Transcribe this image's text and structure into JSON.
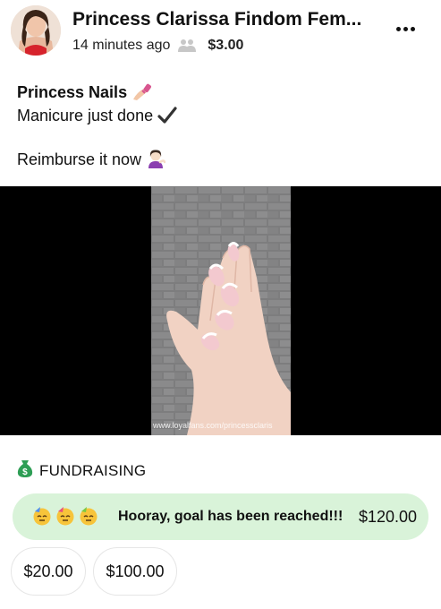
{
  "post": {
    "author": "Princess Clarissa Findom Fem...",
    "time": "14 minutes ago",
    "price": "$3.00",
    "title": "Princess Nails",
    "line1": "Manicure just done",
    "line2": "Reimburse it now",
    "watermark": "www.loyalfans.com/princessclaris"
  },
  "icons": {
    "title_emoji": "nail-polish-icon",
    "line1_emoji": "check-mark-icon",
    "line2_emoji": "woman-tipping-hand-icon",
    "audience": "group-icon",
    "more": "more-dots-icon",
    "fund": "money-bag-icon",
    "goal_emoji": "partying-face-icon"
  },
  "fundraising": {
    "header": "FUNDRAISING",
    "goal_message": "Hooray, goal has been reached!!!",
    "goal_amount": "$120.00",
    "options": [
      "$20.00",
      "$100.00"
    ]
  },
  "colors": {
    "goal_bg": "#d9f3d9",
    "fund_icon": "#2e9e55",
    "media_bg": "#000000"
  }
}
